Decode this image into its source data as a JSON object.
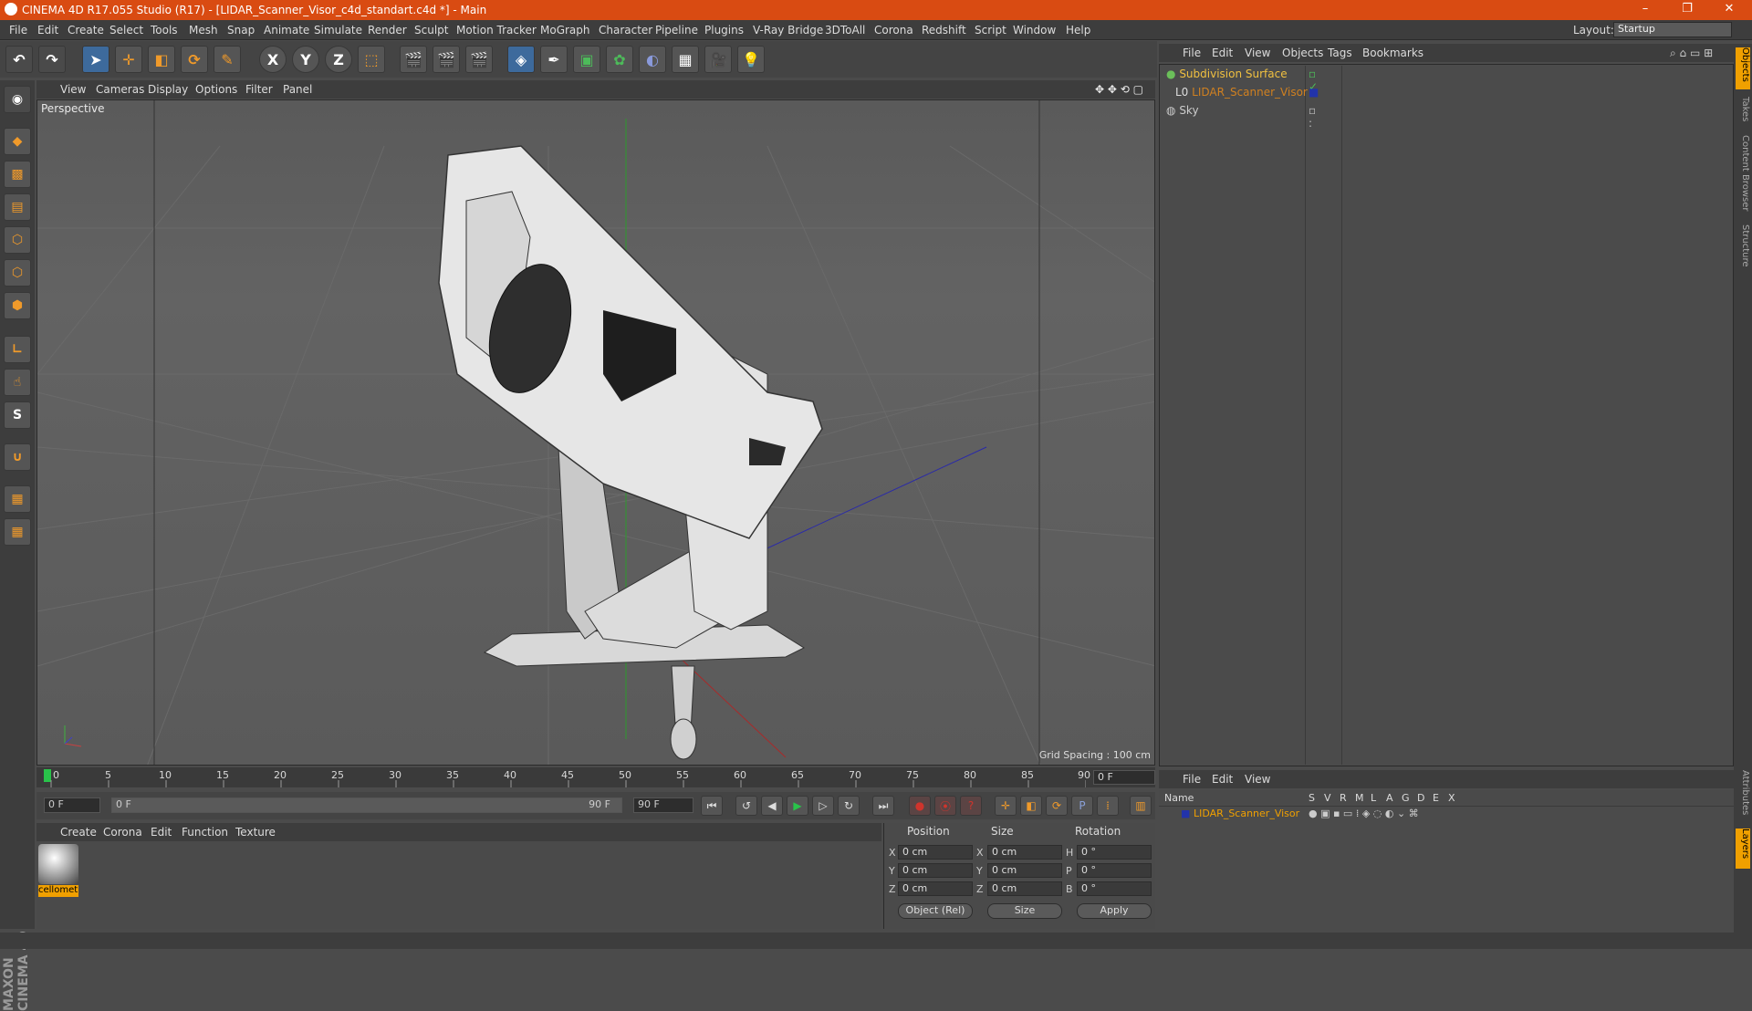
{
  "title": "CINEMA 4D R17.055 Studio (R17) - [LIDAR_Scanner_Visor_c4d_standart.c4d *] - Main",
  "window_controls": {
    "minimize": "–",
    "restore": "❐",
    "close": "✕"
  },
  "menu": [
    "File",
    "Edit",
    "Create",
    "Select",
    "Tools",
    "Mesh",
    "Snap",
    "Animate",
    "Simulate",
    "Render",
    "Sculpt",
    "Motion Tracker",
    "MoGraph",
    "Character",
    "Pipeline",
    "Plugins",
    "V-Ray Bridge",
    "3DToAll",
    "Corona",
    "Redshift",
    "Script",
    "Window",
    "Help"
  ],
  "layout": {
    "label": "Layout:",
    "value": "Startup"
  },
  "toolbar": {
    "axis_x": "X",
    "axis_y": "Y",
    "axis_z": "Z"
  },
  "viewport": {
    "menu": [
      "View",
      "Cameras",
      "Display",
      "Options",
      "Filter",
      "Panel"
    ],
    "label": "Perspective",
    "grid_spacing": "Grid Spacing : 100 cm"
  },
  "timeline": {
    "ticks": [
      "0",
      "5",
      "10",
      "15",
      "20",
      "25",
      "30",
      "35",
      "40",
      "45",
      "50",
      "55",
      "60",
      "65",
      "70",
      "75",
      "80",
      "85",
      "90"
    ],
    "current_frame": "0 F",
    "start_field": "0 F",
    "range_start": "0 F",
    "range_end": "90 F",
    "end_field": "90 F"
  },
  "material_manager": {
    "menu": [
      "Create",
      "Corona",
      "Edit",
      "Function",
      "Texture"
    ],
    "material_name": "cellomet"
  },
  "coordinates": {
    "headers": [
      "Position",
      "Size",
      "Rotation"
    ],
    "rows": [
      {
        "axis": "X",
        "pos": "0 cm",
        "size_axis": "X",
        "size": "0 cm",
        "rot_axis": "H",
        "rot": "0 °"
      },
      {
        "axis": "Y",
        "pos": "0 cm",
        "size_axis": "Y",
        "size": "0 cm",
        "rot_axis": "P",
        "rot": "0 °"
      },
      {
        "axis": "Z",
        "pos": "0 cm",
        "size_axis": "Z",
        "size": "0 cm",
        "rot_axis": "B",
        "rot": "0 °"
      }
    ],
    "mode": "Object (Rel)",
    "size_mode": "Size",
    "apply": "Apply"
  },
  "object_manager": {
    "menu": [
      "File",
      "Edit",
      "View",
      "Objects",
      "Tags",
      "Bookmarks"
    ],
    "objects": [
      {
        "name": "Subdivision Surface",
        "color": "#f0c040"
      },
      {
        "name": "LIDAR_Scanner_Visor",
        "color": "#d08020"
      },
      {
        "name": "Sky",
        "color": "#cccccc"
      }
    ]
  },
  "layer_manager": {
    "menu": [
      "File",
      "Edit",
      "View"
    ],
    "columns": [
      "Name",
      "S",
      "V",
      "R",
      "M",
      "L",
      "A",
      "G",
      "D",
      "E",
      "X"
    ],
    "layer": "LIDAR_Scanner_Visor"
  },
  "right_tabs": [
    "Objects",
    "Takes",
    "Content Browser",
    "Structure",
    "Attributes",
    "Layers"
  ],
  "brand": "MAXON CINEMA 4D"
}
